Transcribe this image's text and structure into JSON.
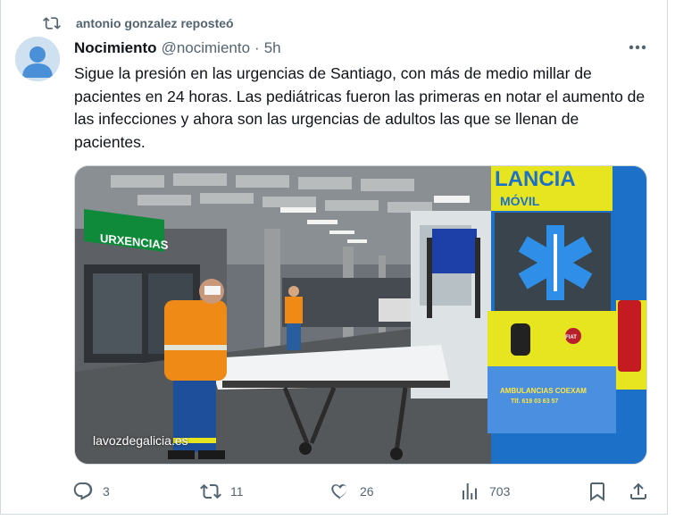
{
  "repost": {
    "label": "antonio gonzalez reposteó",
    "icon": "repost-icon"
  },
  "tweet": {
    "author_name": "Nocimiento",
    "handle": "@nocimiento",
    "separator": "·",
    "time": "5h",
    "text": "Sigue la presión en las urgencias de Santiago, con más de medio millar de pacientes en 24 horas. Las pediátricas fueron las primeras en notar el aumento de las infecciones y ahora son las urgencias de adultos las que se llenan de pacientes."
  },
  "media": {
    "watermark": "lavozdegalicia.es",
    "sign_text": "URXENCIAS",
    "ambulance_top": "LANCIA",
    "ambulance_sub": "MÓVIL",
    "ambulance_company": "AMBULANCIAS COEXAM",
    "ambulance_phone": "Tlf. 619 03 63 57",
    "brand_badge": "FIAT"
  },
  "actions": {
    "replies": "3",
    "reposts": "11",
    "likes": "26",
    "views": "703"
  },
  "colors": {
    "text_primary": "#0f1419",
    "text_secondary": "#536471",
    "border": "#cfd9de",
    "ambulance_yellow": "#e6e51f",
    "ambulance_blue": "#1d70c8",
    "vest_orange": "#f08a16"
  }
}
